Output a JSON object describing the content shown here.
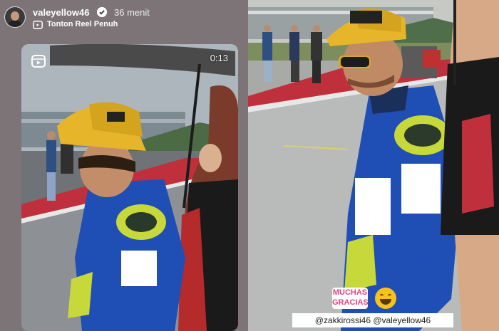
{
  "story": {
    "username": "valeyellow46",
    "time_ago": "36 menit",
    "reel_link": "Tonton Reel Penuh",
    "menu_glyph": "⋮"
  },
  "video": {
    "duration": "0:13"
  },
  "right_photo": {
    "sticker_text": "MUCHAS GRACIAS",
    "mentions": "@zakkirossi46 @valeyellow46"
  },
  "icons": {
    "verified": "verified-badge-icon",
    "reel": "reel-icon",
    "more": "more-options-icon",
    "emoji": "grinning-face-emoji"
  },
  "colors": {
    "left_panel_bg": "#7d7478",
    "suit_blue": "#1f4fb5",
    "suit_yellow_green": "#c6d83a",
    "cap_yellow": "#e6b52a",
    "track_red": "#c0303c",
    "sticker_pink": "#e0457b"
  }
}
